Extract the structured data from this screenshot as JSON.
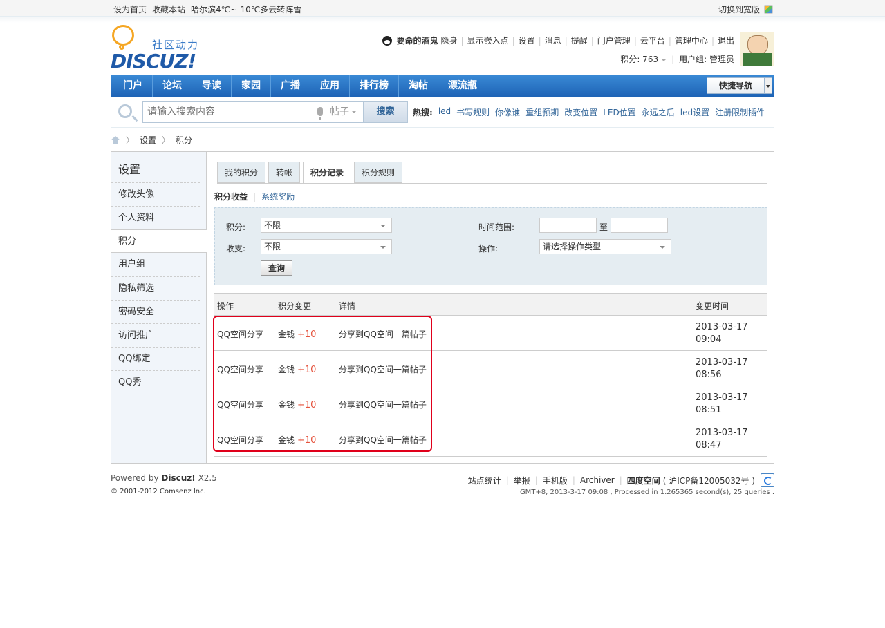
{
  "topbar": {
    "left": [
      "设为首页",
      "收藏本站",
      "哈尔滨4℃~-10℃多云转阵雪"
    ],
    "wide_label": "切换到宽版"
  },
  "logo": {
    "cn": "社区动力",
    "en": "DISCUZ!"
  },
  "user": {
    "name": "要命的酒鬼",
    "links": [
      "隐身",
      "显示嵌入点",
      "设置",
      "消息",
      "提醒",
      "门户管理",
      "云平台",
      "管理中心",
      "退出"
    ],
    "credits": "积分: 763",
    "group": "用户组: 管理员"
  },
  "nav": {
    "items": [
      "门户",
      "论坛",
      "导读",
      "家园",
      "广播",
      "应用",
      "排行榜",
      "淘帖",
      "漂流瓶"
    ],
    "quick": "快捷导航"
  },
  "search": {
    "placeholder": "请输入搜索内容",
    "type": "帖子",
    "button": "搜索",
    "hot_label": "热搜:",
    "hot": [
      "led",
      "书写规则",
      "你像谁",
      "重组预期",
      "改变位置",
      "LED位置",
      "永远之后",
      "led设置",
      "注册限制插件"
    ]
  },
  "breadcrumb": [
    "设置",
    "积分"
  ],
  "sidebar": {
    "title": "设置",
    "items": [
      "修改头像",
      "个人资料",
      "积分",
      "用户组",
      "隐私筛选",
      "密码安全",
      "访问推广",
      "QQ绑定",
      "QQ秀"
    ],
    "active_index": 2
  },
  "tabs": [
    "我的积分",
    "转帐",
    "积分记录",
    "积分规则"
  ],
  "active_tab": 2,
  "subtabs": {
    "active": "积分收益",
    "other": "系统奖励"
  },
  "filter": {
    "credit_label": "积分:",
    "credit_value": "不限",
    "income_label": "收支:",
    "income_value": "不限",
    "time_label": "时间范围:",
    "to": "至",
    "op_label": "操作:",
    "op_value": "请选择操作类型",
    "query": "查询"
  },
  "table": {
    "headers": [
      "操作",
      "积分变更",
      "详情",
      "变更时间"
    ],
    "rows": [
      {
        "op": "QQ空间分享",
        "credit": "金钱",
        "change": "+10",
        "detail": "分享到QQ空间一篇帖子",
        "date": "2013-03-17",
        "time": "09:04"
      },
      {
        "op": "QQ空间分享",
        "credit": "金钱",
        "change": "+10",
        "detail": "分享到QQ空间一篇帖子",
        "date": "2013-03-17",
        "time": "08:56"
      },
      {
        "op": "QQ空间分享",
        "credit": "金钱",
        "change": "+10",
        "detail": "分享到QQ空间一篇帖子",
        "date": "2013-03-17",
        "time": "08:51"
      },
      {
        "op": "QQ空间分享",
        "credit": "金钱",
        "change": "+10",
        "detail": "分享到QQ空间一篇帖子",
        "date": "2013-03-17",
        "time": "08:47"
      }
    ]
  },
  "footer": {
    "powered": "Powered by",
    "brand": "Discuz!",
    "version": "X2.5",
    "copyright": "© 2001-2012 Comsenz Inc.",
    "links": [
      "站点统计",
      "举报",
      "手机版",
      "Archiver"
    ],
    "site": "四度空间",
    "icp": "( 沪ICP备12005032号 )",
    "gmt": "GMT+8, 2013-3-17 09:08 , Processed in 1.265365 second(s), 25 queries ."
  },
  "colors": {
    "nav": "#1d62b5",
    "plus": "#e5533d",
    "highlight": "#e0001b",
    "link": "#336699"
  }
}
